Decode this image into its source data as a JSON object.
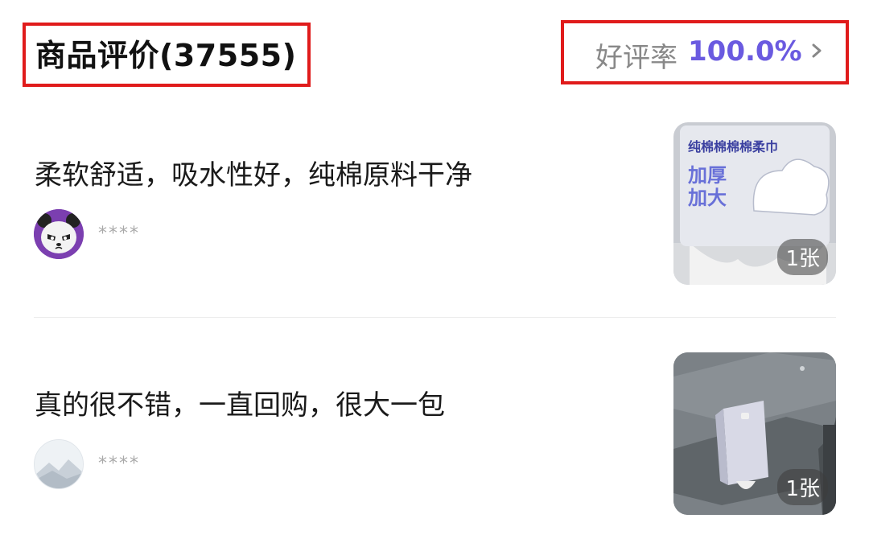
{
  "header": {
    "title": "商品评价(37555)",
    "rate_label": "好评率",
    "rate_value": "100.0%"
  },
  "reviews": [
    {
      "text": "柔软舒适，吸水性好，纯棉原料干净",
      "username": "****",
      "photo_count": "1张",
      "thumb": {
        "line1": "纯棉棉棉棉柔巾",
        "line2": "加厚",
        "line3": "加大"
      }
    },
    {
      "text": "真的很不错，一直回购，很大一包",
      "username": "****",
      "photo_count": "1张"
    }
  ],
  "colors": {
    "accent": "#6a5ae0",
    "highlight_border": "#e01b1b"
  }
}
